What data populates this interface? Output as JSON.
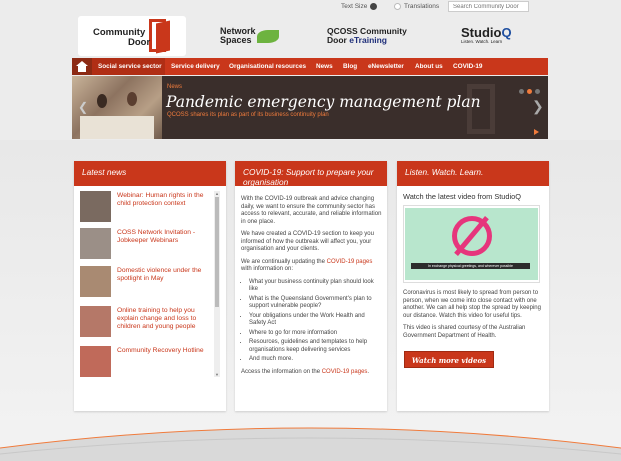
{
  "utility": {
    "text_size": "Text Size",
    "translations": "Translations",
    "search_placeholder": "Search Community Door"
  },
  "logos": {
    "community_door_line1": "Community",
    "community_door_line2": "Door",
    "network_spaces_line1": "Network",
    "network_spaces_line2": "Spaces",
    "qcoss_line1": "QCOSS Community",
    "qcoss_line2a": "Door",
    "qcoss_line2b": "eTraining",
    "studioq_a": "Studio",
    "studioq_b": "Q",
    "studioq_tagline": "Listen. Watch. Learn"
  },
  "nav": {
    "items": [
      "Social service sector",
      "Service delivery",
      "Organisational resources",
      "News",
      "Blog",
      "eNewsletter",
      "About us",
      "COVID-19"
    ]
  },
  "banner": {
    "tag": "News",
    "title": "Pandemic emergency management plan",
    "subtitle": "QCOSS shares its plan as part of its business continuity plan"
  },
  "latest_news": {
    "heading": "Latest news",
    "items": [
      {
        "text": "Webinar: Human rights in the child protection context",
        "thumb_color": "#7a6a60"
      },
      {
        "text": "COSS Network Invitation - Jobkeeper Webinars",
        "thumb_color": "#9b8f87"
      },
      {
        "text": "Domestic violence under the spotlight in May",
        "thumb_color": "#a98a72"
      },
      {
        "text": "Online training to help you explain change and loss to children and young people",
        "thumb_color": "#b57868"
      },
      {
        "text": "Community Recovery Hotline",
        "thumb_color": "#c06a5a"
      }
    ]
  },
  "covid": {
    "heading": "COVID-19: Support to prepare your organisation",
    "p1": "With the COVID-19 outbreak and advice changing daily, we want to ensure the community sector has access to relevant, accurate, and reliable information in one place.",
    "p2": "We have created a COVID-19 section to keep you informed of how the outbreak will affect you, your organisation and your clients.",
    "p3_pre": "We are continually updating the ",
    "p3_link": "COVID-19 pages",
    "p3_post": " with information on:",
    "bullets": [
      "What your business continuity plan should look like",
      "What is the Queensland Government's plan to support vulnerable people?",
      "Your obligations under the Work Health and Safety Act",
      "Where to go for more information",
      "Resources, guidelines and templates to help organisations keep delivering services",
      "And much more."
    ],
    "p4_pre": "Access the information on the ",
    "p4_link": "COVID-19 pages",
    "p4_post": "."
  },
  "studioq": {
    "heading": "Listen. Watch. Learn.",
    "title": "Watch the latest video from StudioQ",
    "video_caption": "In exchange physical greetings, and wherever possible",
    "p1": "Coronavirus is most likely to spread from person to person, when we come into close contact with one another. We can all help stop the spread by keeping our distance. Watch this video for useful tips.",
    "p2": "This video is shared courtesy of the Australian Government Department of Health.",
    "button": "Watch more videos"
  },
  "colors": {
    "brand_red": "#c9371b",
    "accent_orange": "#f07b3c",
    "banner_bg": "#3a2e2b"
  }
}
